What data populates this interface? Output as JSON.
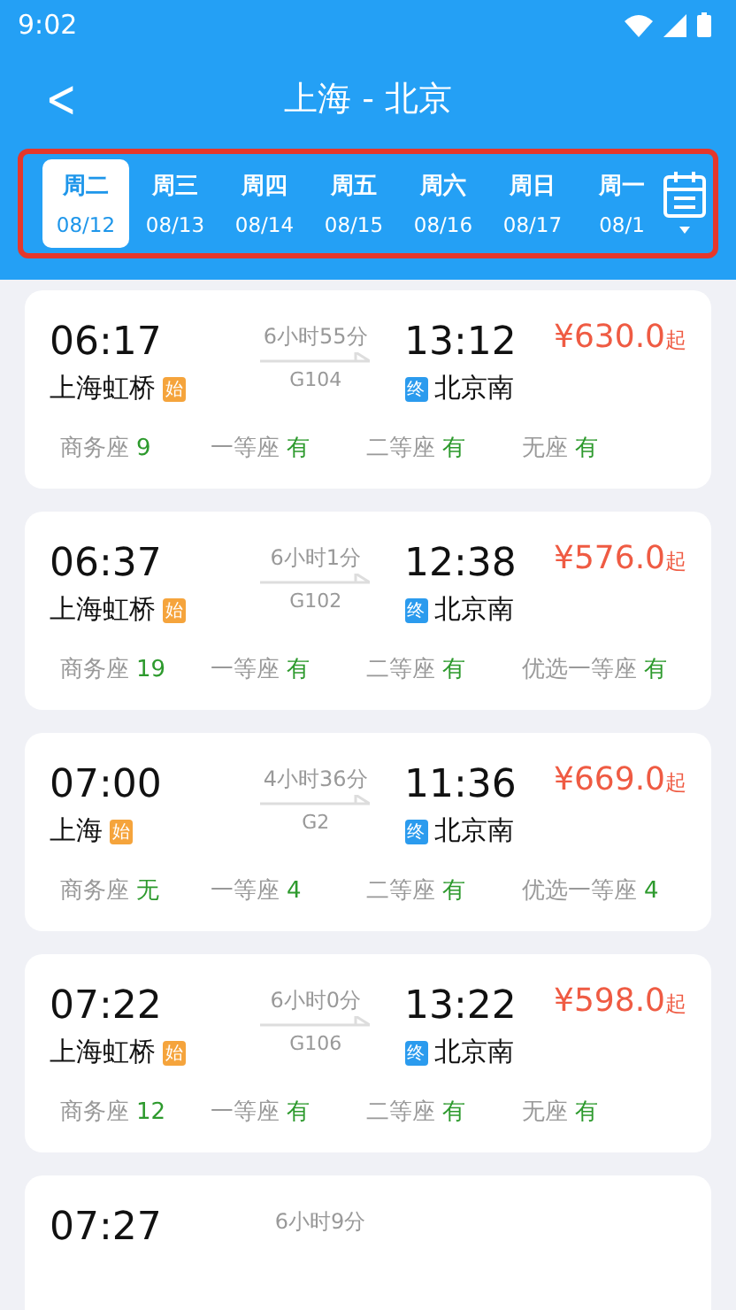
{
  "status_bar": {
    "time": "9:02"
  },
  "header": {
    "back": "<",
    "title": "上海 - 北京"
  },
  "dates": [
    {
      "weekday": "周二",
      "date": "08/12",
      "selected": true
    },
    {
      "weekday": "周三",
      "date": "08/13",
      "selected": false
    },
    {
      "weekday": "周四",
      "date": "08/14",
      "selected": false
    },
    {
      "weekday": "周五",
      "date": "08/15",
      "selected": false
    },
    {
      "weekday": "周六",
      "date": "08/16",
      "selected": false
    },
    {
      "weekday": "周日",
      "date": "08/17",
      "selected": false
    },
    {
      "weekday": "周一",
      "date": "08/1",
      "selected": false
    }
  ],
  "trains": [
    {
      "depart": "06:17",
      "duration": "6小时55分",
      "arrive": "13:12",
      "price": "¥630.0",
      "price_suffix": "起",
      "from": "上海虹桥",
      "from_badge": "始",
      "train": "G104",
      "to_badge": "终",
      "to": "北京南",
      "seats": [
        {
          "label": "商务座",
          "value": "9"
        },
        {
          "label": "一等座",
          "value": "有"
        },
        {
          "label": "二等座",
          "value": "有"
        },
        {
          "label": "无座",
          "value": "有"
        }
      ]
    },
    {
      "depart": "06:37",
      "duration": "6小时1分",
      "arrive": "12:38",
      "price": "¥576.0",
      "price_suffix": "起",
      "from": "上海虹桥",
      "from_badge": "始",
      "train": "G102",
      "to_badge": "终",
      "to": "北京南",
      "seats": [
        {
          "label": "商务座",
          "value": "19"
        },
        {
          "label": "一等座",
          "value": "有"
        },
        {
          "label": "二等座",
          "value": "有"
        },
        {
          "label": "优选一等座",
          "value": "有"
        }
      ]
    },
    {
      "depart": "07:00",
      "duration": "4小时36分",
      "arrive": "11:36",
      "price": "¥669.0",
      "price_suffix": "起",
      "from": "上海",
      "from_badge": "始",
      "train": "G2",
      "to_badge": "终",
      "to": "北京南",
      "seats": [
        {
          "label": "商务座",
          "value": "无"
        },
        {
          "label": "一等座",
          "value": "4"
        },
        {
          "label": "二等座",
          "value": "有"
        },
        {
          "label": "优选一等座",
          "value": "4"
        }
      ]
    },
    {
      "depart": "07:22",
      "duration": "6小时0分",
      "arrive": "13:22",
      "price": "¥598.0",
      "price_suffix": "起",
      "from": "上海虹桥",
      "from_badge": "始",
      "train": "G106",
      "to_badge": "终",
      "to": "北京南",
      "seats": [
        {
          "label": "商务座",
          "value": "12"
        },
        {
          "label": "一等座",
          "value": "有"
        },
        {
          "label": "二等座",
          "value": "有"
        },
        {
          "label": "无座",
          "value": "有"
        }
      ]
    },
    {
      "depart": "07:27",
      "duration": "6小时9分"
    }
  ]
}
